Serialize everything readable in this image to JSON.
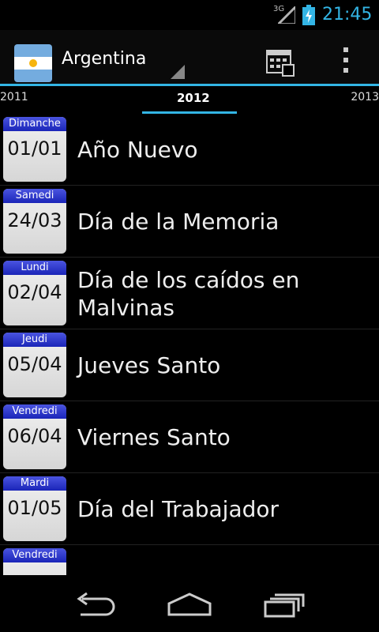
{
  "status_bar": {
    "network": "3G",
    "time": "21:45"
  },
  "action_bar": {
    "country": "Argentina"
  },
  "years": {
    "previous": "2011",
    "current": "2012",
    "next": "2013"
  },
  "holidays": [
    {
      "weekday": "Dimanche",
      "date": "01/01",
      "name": "Año Nuevo"
    },
    {
      "weekday": "Samedi",
      "date": "24/03",
      "name": "Día de la Memoria"
    },
    {
      "weekday": "Lundi",
      "date": "02/04",
      "name": "Día de los caídos en Malvinas"
    },
    {
      "weekday": "Jeudi",
      "date": "05/04",
      "name": "Jueves Santo"
    },
    {
      "weekday": "Vendredi",
      "date": "06/04",
      "name": "Viernes Santo"
    },
    {
      "weekday": "Mardi",
      "date": "01/05",
      "name": "Día del Trabajador"
    },
    {
      "weekday": "Vendredi",
      "date": "",
      "name": ""
    }
  ],
  "colors": {
    "accent": "#33b5e5",
    "tile_header": "#2a35cc"
  }
}
